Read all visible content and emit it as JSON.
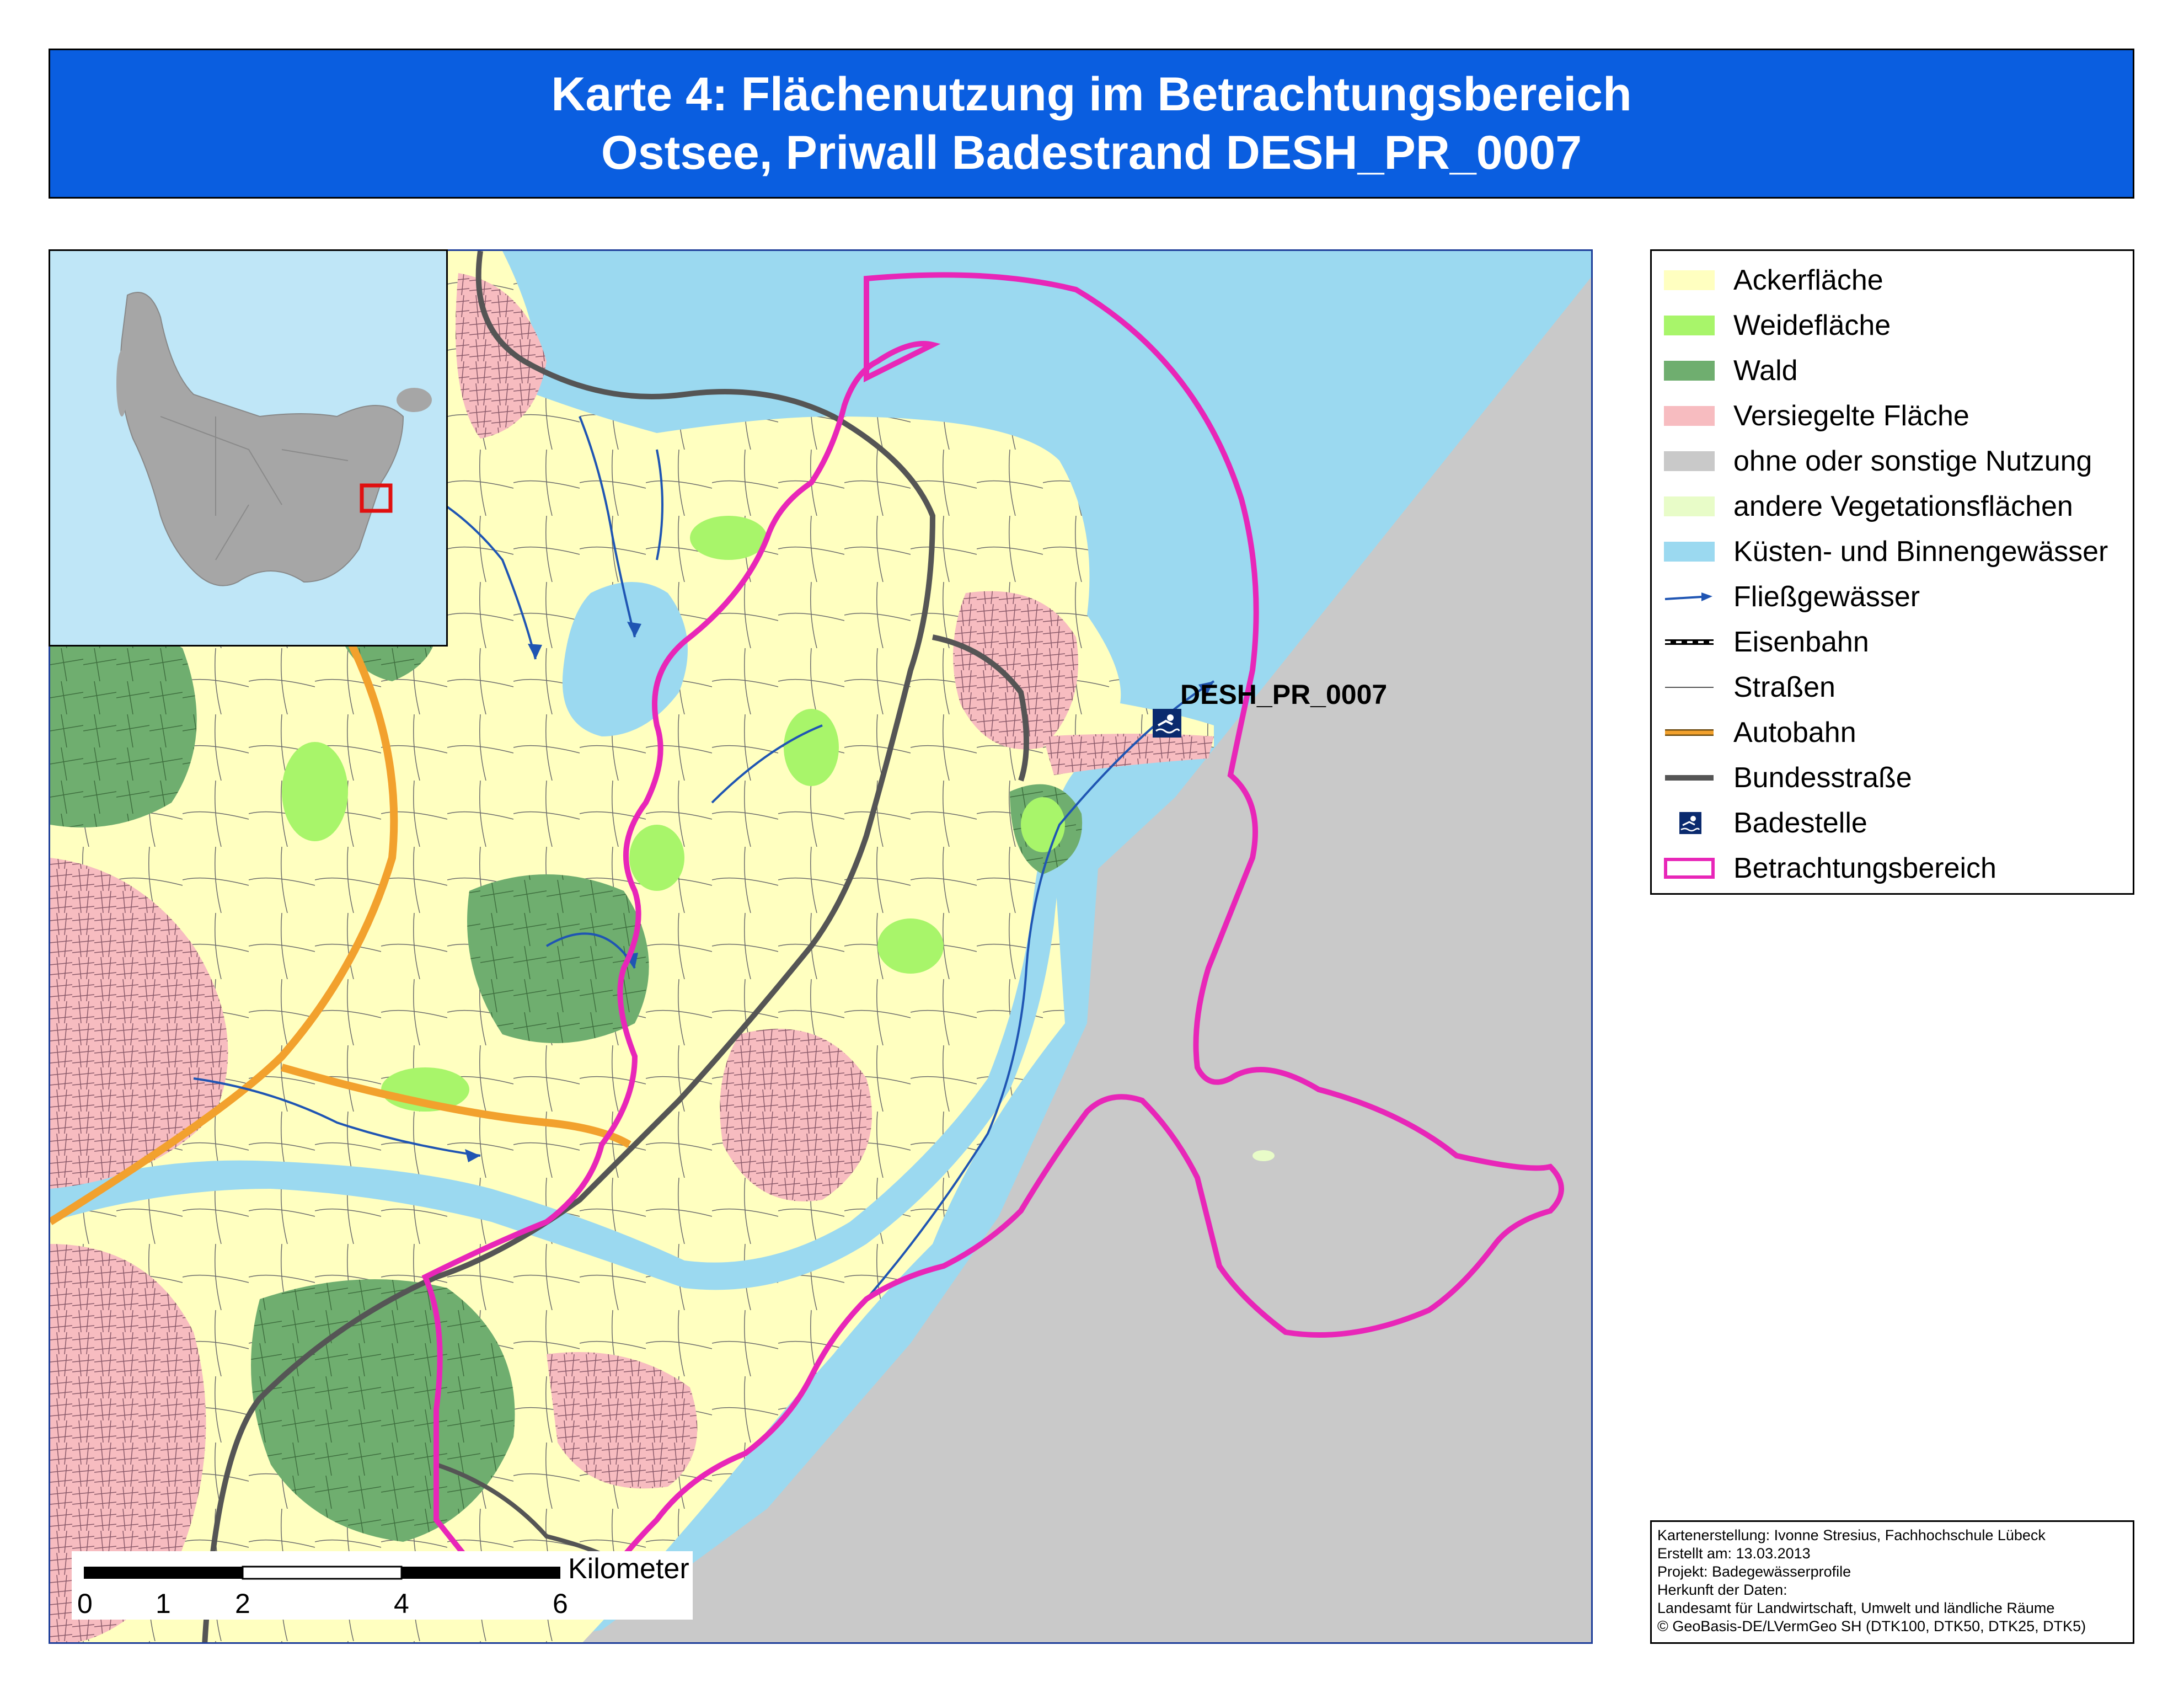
{
  "title": {
    "line1": "Karte 4: Flächenutzung im Betrachtungsbereich",
    "line2": "Ostsee, Priwall Badestrand DESH_PR_0007"
  },
  "map": {
    "site_label": "DESH_PR_0007",
    "site_icon": "bathing-site-icon"
  },
  "colors": {
    "title_bar": "#0a5ee0",
    "ackerflaeche": "#ffffc0",
    "weideflaeche": "#a8f56a",
    "wald": "#6fae6f",
    "versiegelt": "#f7bcc0",
    "sonstige": "#c9c9c9",
    "andere_vegetation": "#e8fcc8",
    "gewaesser": "#9bd9f0",
    "fliessgewaesser": "#1f55b3",
    "autobahn": "#f2a12d",
    "bundesstrasse": "#555555",
    "betrachtungsbereich": "#e826b8",
    "inset_sea": "#bfe6f7",
    "inset_land": "#a6a6a6",
    "inset_marker": "#e01010"
  },
  "legend": {
    "items": [
      {
        "label": "Ackerfläche",
        "kind": "fill",
        "color": "#ffffc0"
      },
      {
        "label": "Weidefläche",
        "kind": "fill",
        "color": "#a8f56a"
      },
      {
        "label": "Wald",
        "kind": "fill",
        "color": "#6fae6f"
      },
      {
        "label": "Versiegelte Fläche",
        "kind": "fill",
        "color": "#f7bcc0"
      },
      {
        "label": "ohne oder sonstige Nutzung",
        "kind": "fill",
        "color": "#c9c9c9"
      },
      {
        "label": "andere Vegetationsflächen",
        "kind": "fill",
        "color": "#e8fcc8"
      },
      {
        "label": "Küsten- und Binnengewässer",
        "kind": "fill",
        "color": "#9bd9f0"
      },
      {
        "label": "Fließgewässer",
        "kind": "river-arrow",
        "color": "#1f55b3"
      },
      {
        "label": "Eisenbahn",
        "kind": "railway",
        "color": "#000000"
      },
      {
        "label": "Straßen",
        "kind": "thin-line",
        "color": "#555555"
      },
      {
        "label": "Autobahn",
        "kind": "motorway",
        "color": "#f2a12d"
      },
      {
        "label": "Bundesstraße",
        "kind": "thick-line",
        "color": "#555555"
      },
      {
        "label": "Badestelle",
        "kind": "bathing-icon",
        "color": "#0a2a6e"
      },
      {
        "label": "Betrachtungsbereich",
        "kind": "outline",
        "color": "#e826b8"
      }
    ]
  },
  "scalebar": {
    "unit_label": "Kilometer",
    "ticks": [
      "0",
      "1",
      "2",
      "4",
      "6"
    ]
  },
  "credits": {
    "lines": [
      "Kartenerstellung: Ivonne Stresius, Fachhochschule Lübeck",
      "Erstellt am: 13.03.2013",
      "Projekt: Badegewässerprofile",
      "Herkunft der Daten:",
      "Landesamt für Landwirtschaft, Umwelt und ländliche Räume",
      "© GeoBasis-DE/LVermGeo SH (DTK100, DTK50, DTK25, DTK5)"
    ]
  }
}
